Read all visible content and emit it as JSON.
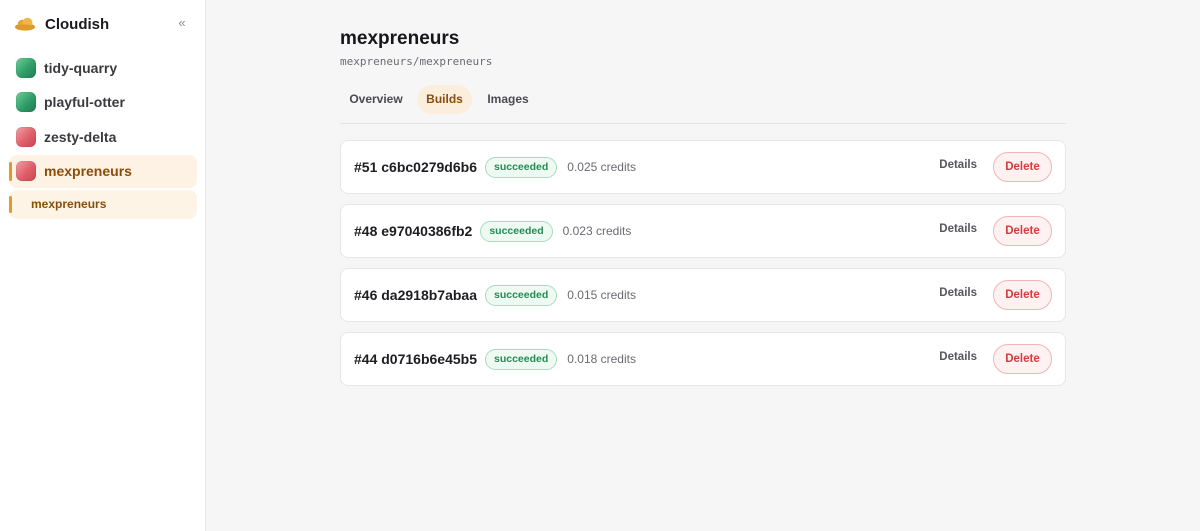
{
  "app": {
    "name": "Cloudish",
    "collapse_label": "«"
  },
  "sidebar": {
    "projects": [
      {
        "label": "tidy-quarry",
        "icon": "green"
      },
      {
        "label": "playful-otter",
        "icon": "green"
      },
      {
        "label": "zesty-delta",
        "icon": "red"
      },
      {
        "label": "mexpreneurs",
        "icon": "red",
        "active": true
      }
    ],
    "sub_items": [
      {
        "label": "mexpreneurs",
        "active": true
      }
    ]
  },
  "page": {
    "title": "mexpreneurs",
    "subtitle": "mexpreneurs/mexpreneurs"
  },
  "tabs": [
    {
      "label": "Overview"
    },
    {
      "label": "Builds",
      "active": true
    },
    {
      "label": "Images"
    }
  ],
  "builds": [
    {
      "id": "#51 c6bc0279d6b6",
      "status": "succeeded",
      "credits": "0.025 credits",
      "details_label": "Details",
      "delete_label": "Delete"
    },
    {
      "id": "#48 e97040386fb2",
      "status": "succeeded",
      "credits": "0.023 credits",
      "details_label": "Details",
      "delete_label": "Delete"
    },
    {
      "id": "#46 da2918b7abaa",
      "status": "succeeded",
      "credits": "0.015 credits",
      "details_label": "Details",
      "delete_label": "Delete"
    },
    {
      "id": "#44 d0716b6e45b5",
      "status": "succeeded",
      "credits": "0.018 credits",
      "details_label": "Details",
      "delete_label": "Delete"
    }
  ],
  "colors": {
    "accent": "#df9a2c",
    "accent_text": "#8a4d0a",
    "success": "#248a55",
    "danger": "#d23d3d"
  },
  "icons": {
    "brand": "cloud-icon",
    "collapse": "double-chevron-left-icon"
  }
}
